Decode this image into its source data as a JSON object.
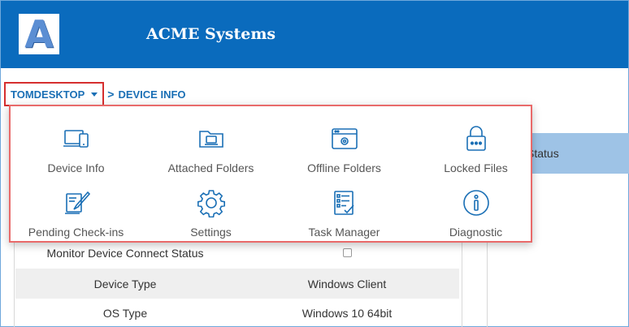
{
  "header": {
    "logo_letter": "A",
    "app_title": "ACME Systems",
    "brand_color": "#0a6bbd"
  },
  "breadcrumb": {
    "device": "TOMDESKTOP",
    "separator": ">",
    "current": "DEVICE INFO"
  },
  "menu": {
    "items": [
      {
        "label": "Device Info",
        "icon": "device-info-icon"
      },
      {
        "label": "Attached Folders",
        "icon": "attached-folders-icon"
      },
      {
        "label": "Offline Folders",
        "icon": "offline-folders-icon"
      },
      {
        "label": "Locked Files",
        "icon": "locked-files-icon"
      },
      {
        "label": "Pending Check-ins",
        "icon": "pending-checkins-icon"
      },
      {
        "label": "Settings",
        "icon": "settings-icon"
      },
      {
        "label": "Task Manager",
        "icon": "task-manager-icon"
      },
      {
        "label": "Diagnostic",
        "icon": "diagnostic-icon"
      }
    ]
  },
  "right_column": {
    "header_partial": "Status"
  },
  "device_table": {
    "rows": [
      {
        "label": "Monitor Device Connect Status",
        "value": ""
      },
      {
        "label": "Device Type",
        "value": "Windows Client"
      },
      {
        "label": "OS Type",
        "value": "Windows 10 64bit"
      }
    ]
  },
  "icon_color": "#1a6fb5"
}
